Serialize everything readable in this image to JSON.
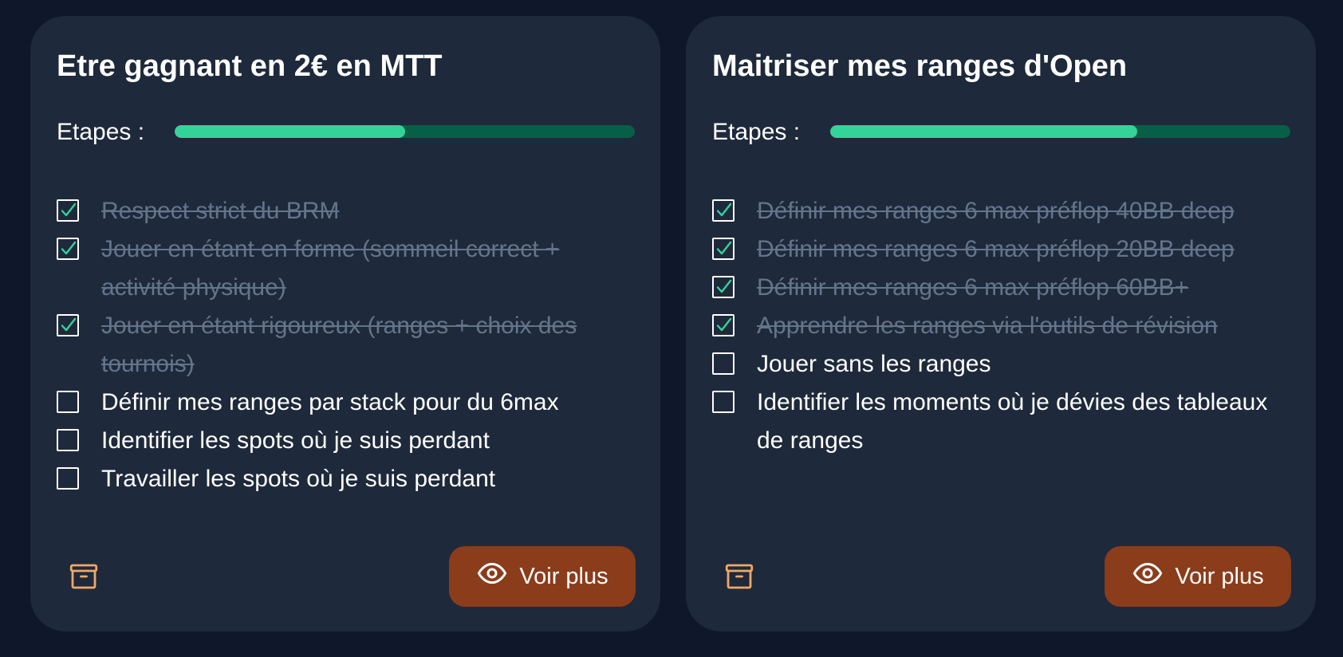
{
  "colors": {
    "page_background": "#0f172a",
    "card_background": "#1e293b",
    "progress_track": "#065f46",
    "progress_fill": "#34d399",
    "checkmark": "#34d399",
    "done_text": "#64748b",
    "button_background": "#8b3c1b",
    "archive_icon": "#f0a868"
  },
  "cards": [
    {
      "title": "Etre gagnant en 2€ en MTT",
      "steps_label": "Etapes :",
      "progress": 0.5,
      "tasks": [
        {
          "text": "Respect strict du BRM",
          "done": true
        },
        {
          "text": "Jouer en étant en forme (sommeil correct + activité physique)",
          "done": true
        },
        {
          "text": "Jouer en étant rigoureux (ranges + choix des tournois)",
          "done": true
        },
        {
          "text": "Définir mes ranges par stack pour du 6max",
          "done": false
        },
        {
          "text": "Identifier les spots où je suis perdant",
          "done": false
        },
        {
          "text": "Travailler les spots où je suis perdant",
          "done": false
        }
      ],
      "archive_icon": "archive-box-icon",
      "view_icon": "eye-icon",
      "view_button_label": "Voir plus"
    },
    {
      "title": "Maitriser mes ranges d'Open",
      "steps_label": "Etapes :",
      "progress": 0.667,
      "tasks": [
        {
          "text": "Définir mes ranges 6 max préflop 40BB deep",
          "done": true
        },
        {
          "text": "Définir mes ranges 6 max préflop 20BB deep",
          "done": true
        },
        {
          "text": "Définir mes ranges 6 max préflop 60BB+",
          "done": true
        },
        {
          "text": "Apprendre les ranges via l'outils de révision",
          "done": true
        },
        {
          "text": "Jouer sans les ranges",
          "done": false
        },
        {
          "text": "Identifier les moments où je dévies des tableaux de ranges",
          "done": false
        }
      ],
      "archive_icon": "archive-box-icon",
      "view_icon": "eye-icon",
      "view_button_label": "Voir plus"
    }
  ]
}
